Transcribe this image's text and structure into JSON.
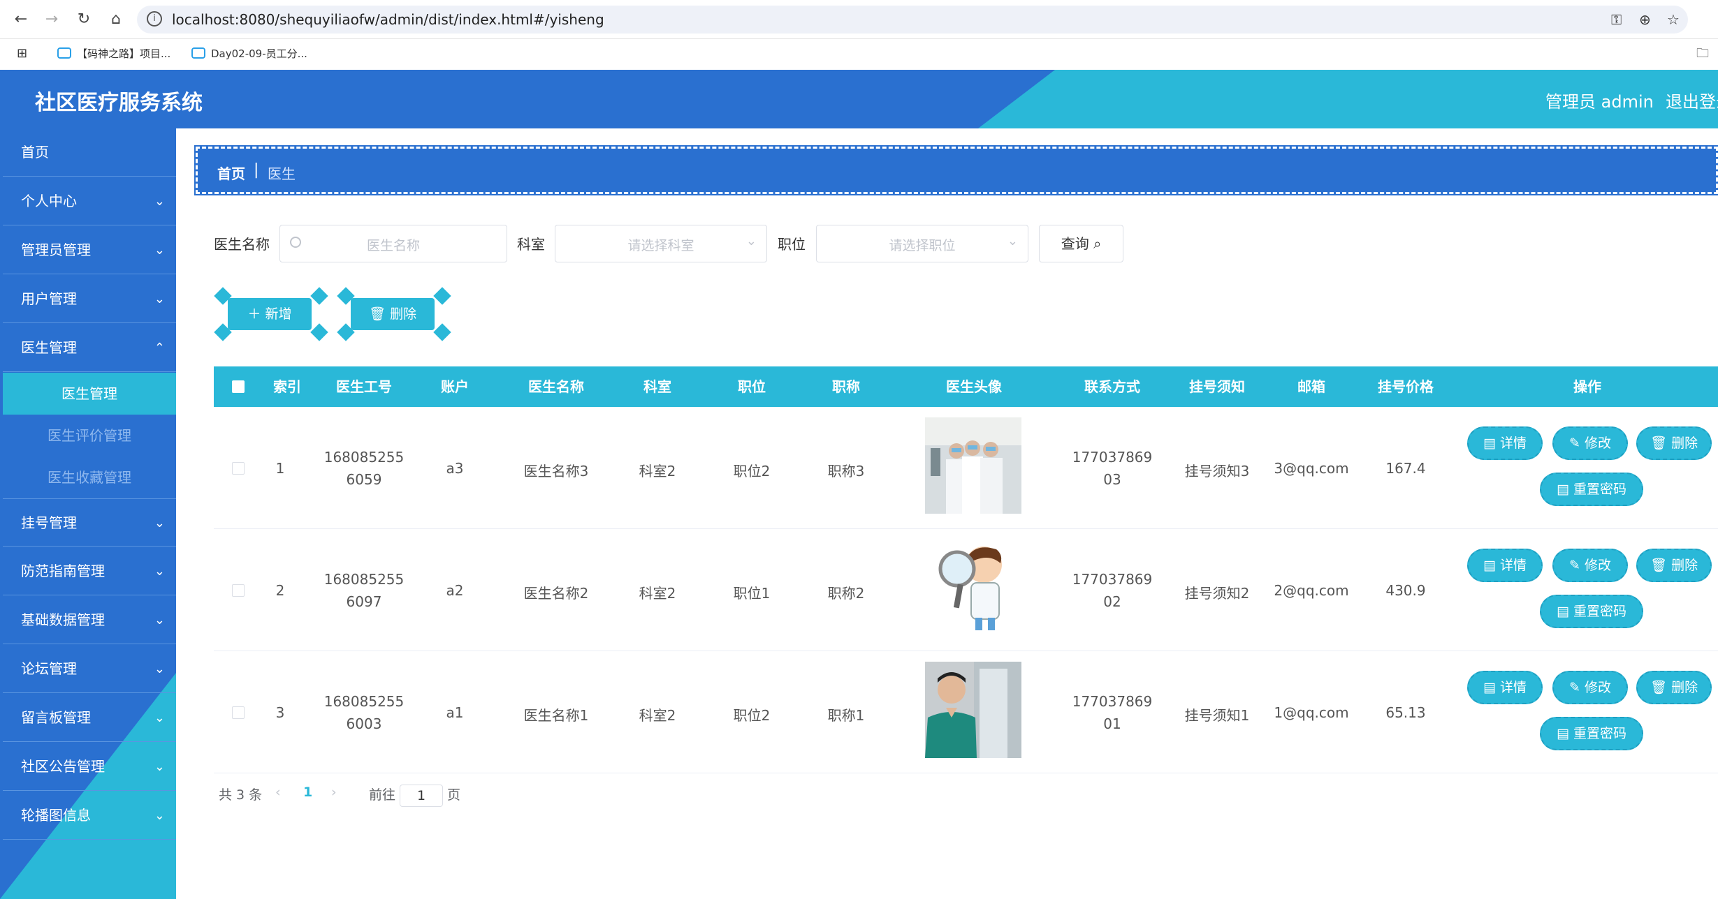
{
  "browser": {
    "url": "localhost:8080/shequyiliaofw/admin/dist/index.html#/yisheng",
    "bookmarks": [
      "【码神之路】项目...",
      "Day02-09-员工分..."
    ]
  },
  "header": {
    "title": "社区医疗服务系统",
    "user": "管理员 admin",
    "logout": "退出登录"
  },
  "sidebar": {
    "items": [
      {
        "label": "首页"
      },
      {
        "label": "个人中心"
      },
      {
        "label": "管理员管理"
      },
      {
        "label": "用户管理"
      },
      {
        "label": "医生管理"
      },
      {
        "label": "挂号管理"
      },
      {
        "label": "防范指南管理"
      },
      {
        "label": "基础数据管理"
      },
      {
        "label": "论坛管理"
      },
      {
        "label": "留言板管理"
      },
      {
        "label": "社区公告管理"
      },
      {
        "label": "轮播图信息"
      }
    ],
    "sub": [
      "医生管理",
      "医生评价管理",
      "医生收藏管理"
    ]
  },
  "breadcrumb": {
    "home": "首页",
    "current": "医生"
  },
  "search": {
    "name_label": "医生名称",
    "name_placeholder": "医生名称",
    "dept_label": "科室",
    "dept_placeholder": "请选择科室",
    "pos_label": "职位",
    "pos_placeholder": "请选择职位",
    "query": "查询"
  },
  "actions": {
    "add": "新增",
    "delete": "删除"
  },
  "table": {
    "headers": [
      "索引",
      "医生工号",
      "账户",
      "医生名称",
      "科室",
      "职位",
      "职称",
      "医生头像",
      "联系方式",
      "挂号须知",
      "邮箱",
      "挂号价格",
      "操作"
    ],
    "rows": [
      {
        "index": "1",
        "id1": "168085255",
        "id2": "6059",
        "account": "a3",
        "name": "医生名称3",
        "dept": "科室2",
        "pos": "职位2",
        "title": "职称3",
        "phone1": "177037869",
        "phone2": "03",
        "notice": "挂号须知3",
        "email": "3@qq.com",
        "price": "167.4"
      },
      {
        "index": "2",
        "id1": "168085255",
        "id2": "6097",
        "account": "a2",
        "name": "医生名称2",
        "dept": "科室2",
        "pos": "职位1",
        "title": "职称2",
        "phone1": "177037869",
        "phone2": "02",
        "notice": "挂号须知2",
        "email": "2@qq.com",
        "price": "430.9"
      },
      {
        "index": "3",
        "id1": "168085255",
        "id2": "6003",
        "account": "a1",
        "name": "医生名称1",
        "dept": "科室2",
        "pos": "职位2",
        "title": "职称1",
        "phone1": "177037869",
        "phone2": "01",
        "notice": "挂号须知1",
        "email": "1@qq.com",
        "price": "65.13"
      }
    ],
    "row_actions": {
      "detail": "详情",
      "edit": "修改",
      "delete": "删除",
      "reset": "重置密码"
    }
  },
  "pagination": {
    "total": "共 3 条",
    "current": "1",
    "goto": "前往",
    "page_value": "1",
    "page_suffix": "页"
  },
  "colors": {
    "primary": "#2a70d0",
    "accent": "#2ab8d8"
  }
}
